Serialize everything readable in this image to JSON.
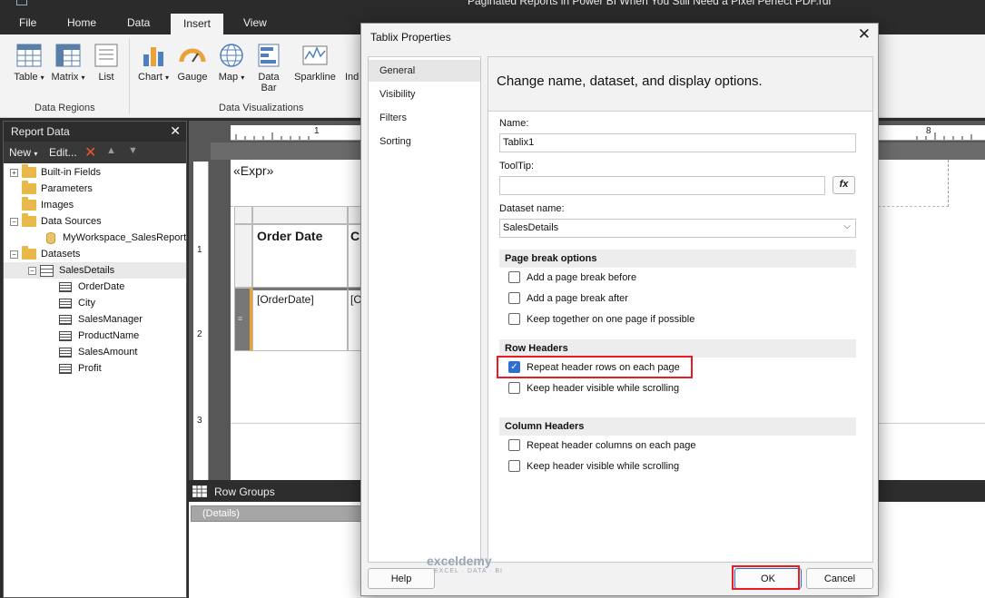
{
  "app": {
    "window_title": "Paginated Reports in Power BI When You Still Need a Pixel Perfect PDF.rdl"
  },
  "ribbon": {
    "tabs": [
      "File",
      "Home",
      "Data",
      "Insert",
      "View"
    ],
    "active_tab": "Insert",
    "buttons": {
      "table": "Table",
      "matrix": "Matrix",
      "list": "List",
      "chart": "Chart",
      "gauge": "Gauge",
      "map": "Map",
      "data_bar_line1": "Data",
      "data_bar_line2": "Bar",
      "sparkline": "Sparkline",
      "indicator": "Ind"
    },
    "groups": {
      "data_regions": "Data Regions",
      "data_visualizations": "Data Visualizations"
    }
  },
  "report_data": {
    "title": "Report Data",
    "new_label": "New",
    "edit_label": "Edit...",
    "tree": {
      "built_in_fields": "Built-in Fields",
      "parameters": "Parameters",
      "images": "Images",
      "data_sources": "Data Sources",
      "data_source_item": "MyWorkspace_SalesReport",
      "datasets": "Datasets",
      "dataset": "SalesDetails",
      "fields": [
        "OrderDate",
        "City",
        "SalesManager",
        "ProductName",
        "SalesAmount",
        "Profit"
      ]
    }
  },
  "design": {
    "ruler_top": {
      "mark1": "1",
      "mark8": "8"
    },
    "ruler_left": {
      "mark1": "1",
      "mark2": "2",
      "mark3": "3"
    },
    "expr": "«Expr»",
    "header_cell_1": "Order Date",
    "header_cell_2": "Ci",
    "detail_cell_1": "[OrderDate]",
    "detail_cell_2": "[C"
  },
  "row_groups": {
    "title": "Row Groups",
    "details": "(Details)"
  },
  "dialog": {
    "title": "Tablix Properties",
    "nav": [
      "General",
      "Visibility",
      "Filters",
      "Sorting"
    ],
    "selected_nav": "General",
    "heading": "Change name, dataset, and display options.",
    "name_label": "Name:",
    "name_value": "Tablix1",
    "tooltip_label": "ToolTip:",
    "tooltip_value": "",
    "fx_label": "fx",
    "dataset_label": "Dataset name:",
    "dataset_value": "SalesDetails",
    "page_break_section": "Page break options",
    "page_break_options": [
      {
        "label": "Add a page break before",
        "checked": false
      },
      {
        "label": "Add a page break after",
        "checked": false
      },
      {
        "label": "Keep together on one page if possible",
        "checked": false
      }
    ],
    "row_headers_section": "Row Headers",
    "row_headers_options": [
      {
        "label": "Repeat header rows on each page",
        "checked": true
      },
      {
        "label": "Keep header visible while scrolling",
        "checked": false
      }
    ],
    "column_headers_section": "Column Headers",
    "column_headers_options": [
      {
        "label": "Repeat header columns on each page",
        "checked": false
      },
      {
        "label": "Keep header visible while scrolling",
        "checked": false
      }
    ],
    "buttons": {
      "help": "Help",
      "ok": "OK",
      "cancel": "Cancel"
    },
    "watermark": {
      "brand": "exceldemy",
      "tagline": "EXCEL · DATA · BI"
    }
  },
  "colors": {
    "accent_blue": "#2e6fd1",
    "highlight_red": "#e81c25",
    "dark_chrome": "#2b2b2b",
    "design_grey": "#575757"
  }
}
